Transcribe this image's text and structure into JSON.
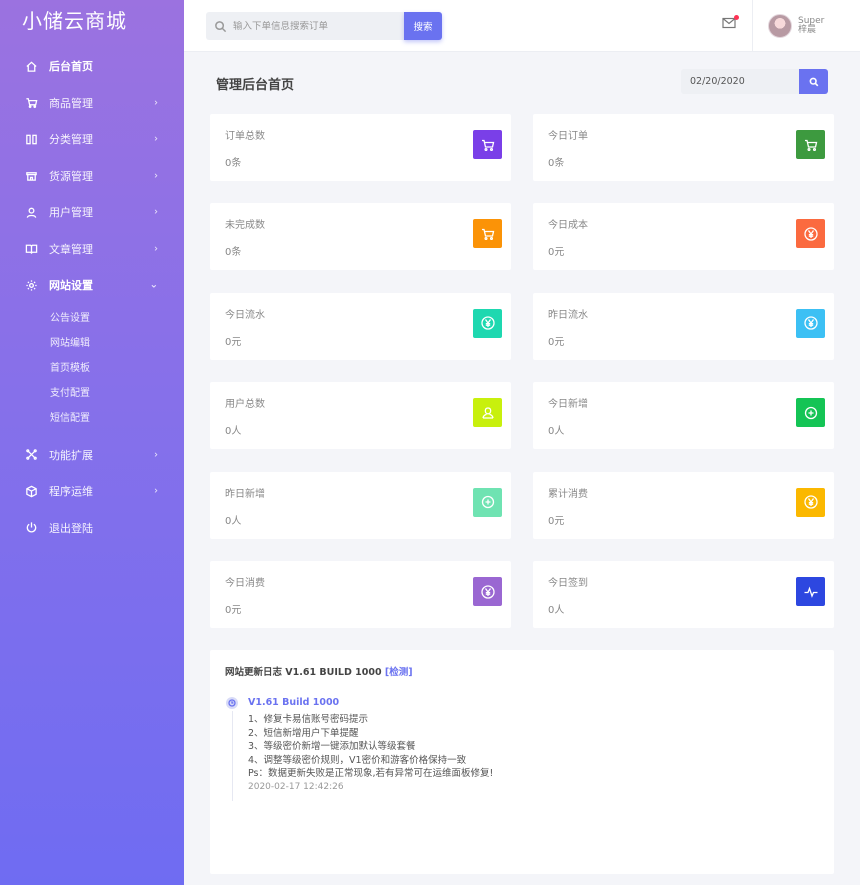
{
  "brand": "小储云商城",
  "sidebar": {
    "items": [
      {
        "label": "后台首页",
        "icon": "home-icon",
        "arrow": ""
      },
      {
        "label": "商品管理",
        "icon": "cart-icon",
        "arrow": "›"
      },
      {
        "label": "分类管理",
        "icon": "columns-icon",
        "arrow": "›"
      },
      {
        "label": "货源管理",
        "icon": "store-icon",
        "arrow": "›"
      },
      {
        "label": "用户管理",
        "icon": "user-icon",
        "arrow": "›"
      },
      {
        "label": "文章管理",
        "icon": "book-icon",
        "arrow": "›"
      },
      {
        "label": "网站设置",
        "icon": "gear-icon",
        "arrow": "⌄"
      }
    ],
    "subitems": [
      "公告设置",
      "网站编辑",
      "首页模板",
      "支付配置",
      "短信配置"
    ],
    "items_after": [
      {
        "label": "功能扩展",
        "icon": "extension-icon",
        "arrow": "›"
      },
      {
        "label": "程序运维",
        "icon": "cube-icon",
        "arrow": "›"
      },
      {
        "label": "退出登陆",
        "icon": "power-icon",
        "arrow": ""
      }
    ]
  },
  "topbar": {
    "search_placeholder": "输入下单信息搜索订单",
    "search_button": "搜索",
    "user_role": "Super",
    "user_name": "梓晨"
  },
  "page": {
    "title": "管理后台首页",
    "date_value": "02/20/2020"
  },
  "cards": [
    {
      "label": "订单总数",
      "value": "0条",
      "icon": "cart-icon",
      "color": "#7a3fe8"
    },
    {
      "label": "今日订单",
      "value": "0条",
      "icon": "cart-icon",
      "color": "#3d9a3f"
    },
    {
      "label": "未完成数",
      "value": "0条",
      "icon": "cart-icon",
      "color": "#fb9307"
    },
    {
      "label": "今日成本",
      "value": "0元",
      "icon": "yen-icon",
      "color": "#fb6a3f"
    },
    {
      "label": "今日流水",
      "value": "0元",
      "icon": "yen-icon",
      "color": "#1ed8b0"
    },
    {
      "label": "昨日流水",
      "value": "0元",
      "icon": "yen-icon",
      "color": "#3cc0f4"
    },
    {
      "label": "用户总数",
      "value": "0人",
      "icon": "user-icon",
      "color": "#c8f00d"
    },
    {
      "label": "今日新增",
      "value": "0人",
      "icon": "plus-circle-icon",
      "color": "#14c455"
    },
    {
      "label": "昨日新增",
      "value": "0人",
      "icon": "plus-circle-icon",
      "color": "#6fe3b2"
    },
    {
      "label": "累计消费",
      "value": "0元",
      "icon": "yen-icon",
      "color": "#fbb800"
    },
    {
      "label": "今日消费",
      "value": "0元",
      "icon": "yen-icon",
      "color": "#9a67d2"
    },
    {
      "label": "今日签到",
      "value": "0人",
      "icon": "pulse-icon",
      "color": "#2d47e0"
    }
  ],
  "changelog": {
    "title": "网站更新日志 V1.61 BUILD 1000 ",
    "check": "[检测]",
    "version": "V1.61 Build 1000",
    "lines": [
      "1、修复卡易信账号密码提示",
      "2、短信新增用户下单提醒",
      "3、等级密价新增一键添加默认等级套餐",
      "4、调整等级密价规则，V1密价和游客价格保持一致",
      "Ps：数据更新失败是正常现象,若有异常可在运维面板修复!"
    ],
    "time": "2020-02-17 12:42:26"
  }
}
